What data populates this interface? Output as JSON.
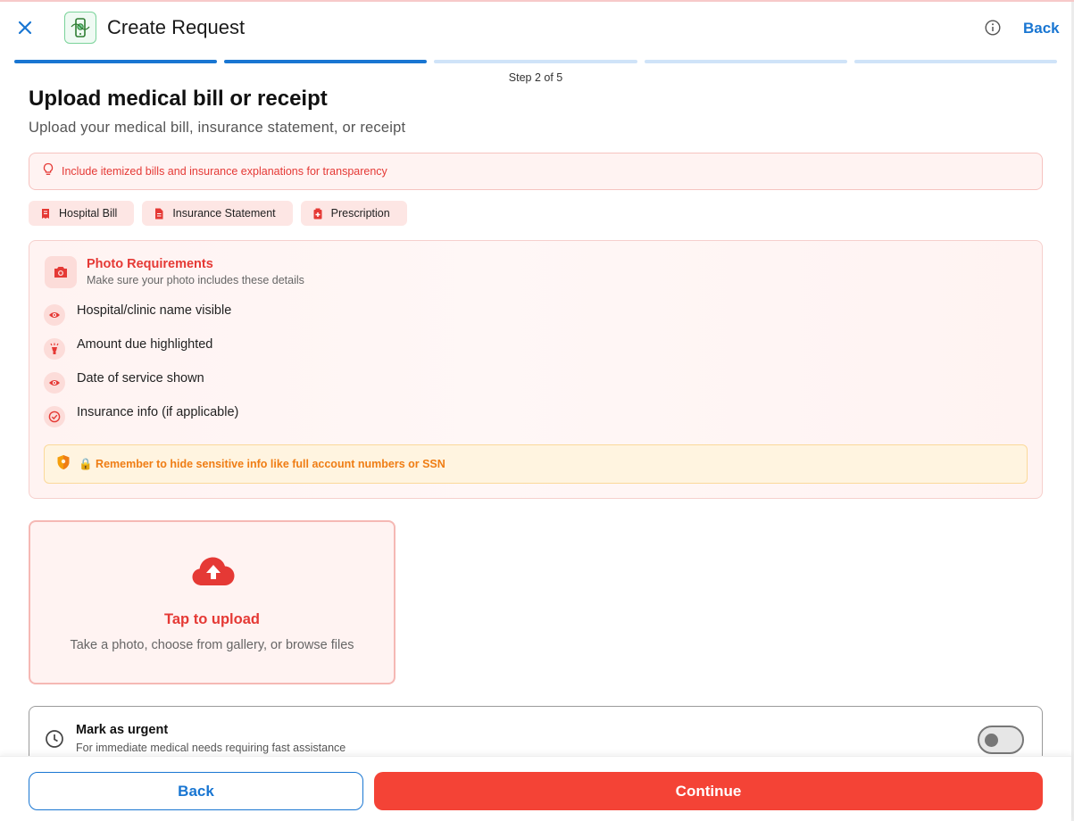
{
  "header": {
    "title": "Create Request",
    "back_label": "Back"
  },
  "progress": {
    "step_text": "Step 2 of 5",
    "current_step": 2,
    "total_steps": 5
  },
  "main": {
    "title": "Upload medical bill or receipt",
    "subtitle": "Upload your medical bill, insurance statement, or receipt",
    "tip": "Include itemized bills and insurance explanations for transparency",
    "chips": [
      {
        "label": "Hospital Bill",
        "icon": "receipt-icon"
      },
      {
        "label": "Insurance Statement",
        "icon": "document-icon"
      },
      {
        "label": "Prescription",
        "icon": "medical-icon"
      }
    ],
    "requirements": {
      "title": "Photo Requirements",
      "subtitle": "Make sure your photo includes these details",
      "items": [
        {
          "label": "Hospital/clinic name visible",
          "icon": "eye-icon"
        },
        {
          "label": "Amount due highlighted",
          "icon": "highlighter-icon"
        },
        {
          "label": "Date of service shown",
          "icon": "eye-icon"
        },
        {
          "label": "Insurance info (if applicable)",
          "icon": "check-circle-icon"
        }
      ],
      "warning": "🔒 Remember to hide sensitive info like full account numbers or SSN"
    },
    "upload": {
      "title": "Tap to upload",
      "subtitle": "Take a photo, choose from gallery, or browse files"
    },
    "urgent": {
      "title": "Mark as urgent",
      "subtitle": "For immediate medical needs requiring fast assistance",
      "enabled": false
    }
  },
  "footer": {
    "back_label": "Back",
    "continue_label": "Continue"
  },
  "colors": {
    "primary_blue": "#1976d2",
    "accent_red": "#f44336",
    "warning_orange": "#ef7d14"
  }
}
